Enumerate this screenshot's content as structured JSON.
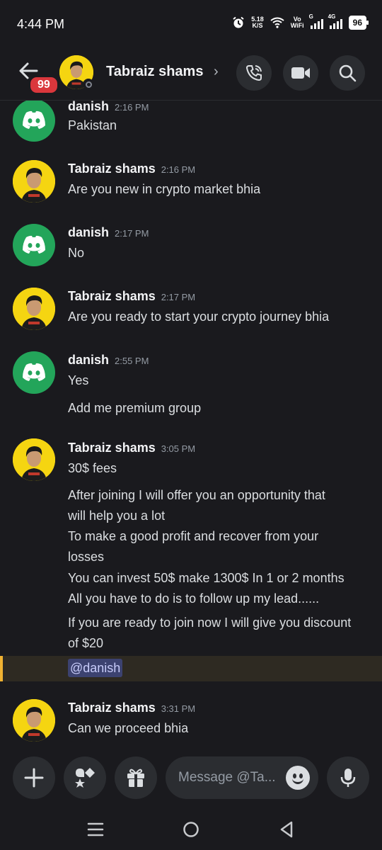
{
  "status_bar": {
    "time": "4:44 PM",
    "net_speed_value": "5.18",
    "net_speed_unit": "K/S",
    "volte_top": "Vo",
    "volte_bottom": "WiFi",
    "signal1_label": "G",
    "signal2_label": "4G",
    "battery": "96"
  },
  "header": {
    "unread_badge": "99",
    "contact_name": "Tabraiz shams",
    "chevron": "›"
  },
  "messages": [
    {
      "author": "danish",
      "time": "2:16 PM",
      "avatar": "discord-avatar",
      "lines": [
        "Pakistan"
      ]
    },
    {
      "author": "Tabraiz shams",
      "time": "2:16 PM",
      "avatar": "user-photo-avatar",
      "lines": [
        "Are you new in crypto market bhia"
      ]
    },
    {
      "author": "danish",
      "time": "2:17 PM",
      "avatar": "discord-avatar",
      "lines": [
        "No"
      ]
    },
    {
      "author": "Tabraiz shams",
      "time": "2:17 PM",
      "avatar": "user-photo-avatar",
      "lines": [
        "Are you ready to start your crypto journey bhia"
      ]
    },
    {
      "author": "danish",
      "time": "2:55 PM",
      "avatar": "discord-avatar",
      "lines": [
        "Yes",
        "Add me premium group"
      ]
    },
    {
      "author": "Tabraiz shams",
      "time": "3:05 PM",
      "avatar": "user-photo-avatar",
      "lines": [
        "30$ fees",
        "After joining I will offer you an opportunity that",
        "will help you a lot",
        "To make a good profit and recover from your",
        "losses",
        "You can invest 50$ make 1300$ In 1 or 2 months",
        "All you have to do is to follow up my lead......",
        "If you are ready to join now I will give you discount",
        "of $20"
      ],
      "mention": "@danish"
    },
    {
      "author": "Tabraiz shams",
      "time": "3:31 PM",
      "avatar": "user-photo-avatar",
      "lines": [
        "Can we proceed bhia"
      ]
    }
  ],
  "composer": {
    "placeholder": "Message @Ta..."
  },
  "colors": {
    "background": "#1a1a1e",
    "discord_green": "#23a55a",
    "avatar_yellow": "#f5d511",
    "badge_red": "#da373c",
    "mention_highlight": "#f0b232"
  }
}
